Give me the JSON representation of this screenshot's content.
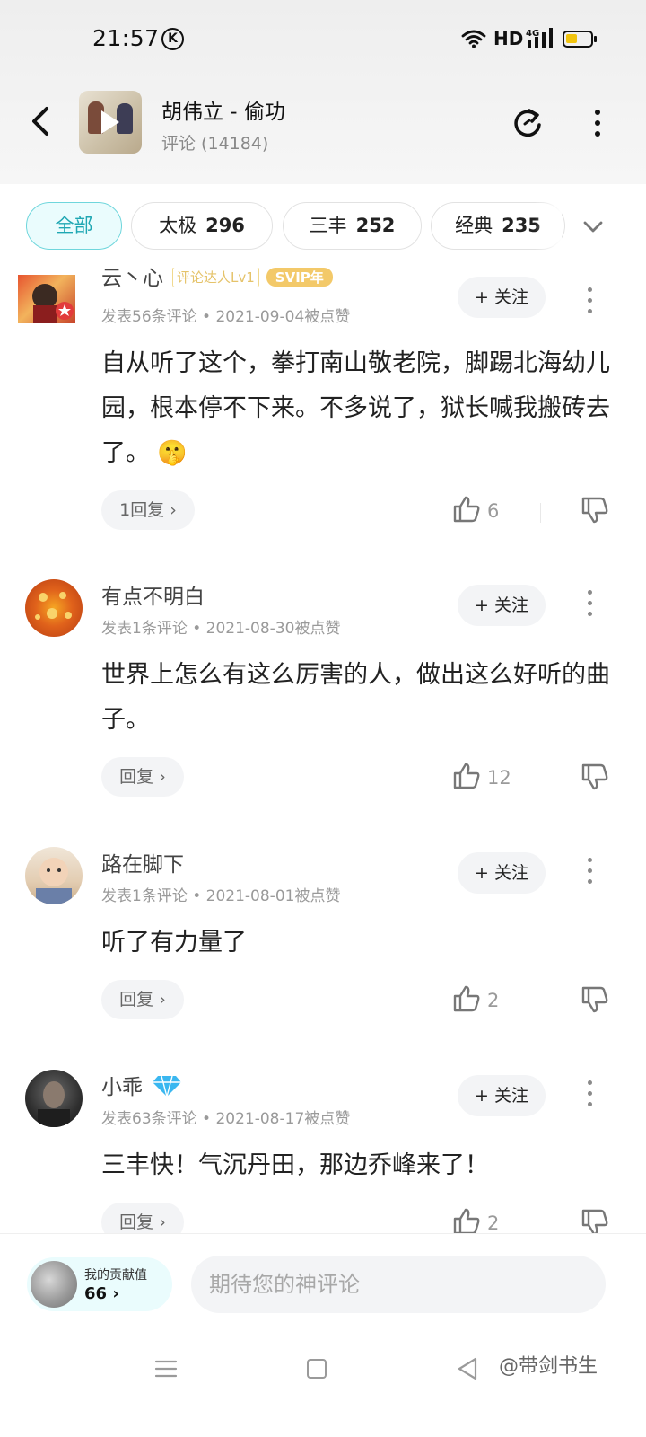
{
  "status_bar": {
    "time": "21:57",
    "k_glyph": "K",
    "network_label": "HD",
    "network_type": "4G",
    "battery_color": "#f1c40f"
  },
  "header": {
    "song_title": "胡伟立 - 偷功",
    "comment_count": "评论 (14184)",
    "album_icon": "album-art",
    "refresh_icon": "refresh-icon"
  },
  "filters": [
    {
      "label": "全部",
      "count": "",
      "active": true
    },
    {
      "label": "太极",
      "count": "296"
    },
    {
      "label": "三丰",
      "count": "252"
    },
    {
      "label": "经典",
      "count": "235"
    }
  ],
  "comments": [
    {
      "username": "云丶心",
      "badge": "评论达人Lv1",
      "vip": "SVIP年",
      "meta": "发表56条评论 • 2021-09-04被点赞",
      "follow": "+ 关注",
      "text": "自从听了这个，拳打南山敬老院，脚踢北海幼儿园，根本停不下来。不多说了，狱长喊我搬砖去了。",
      "emoji": "🤫",
      "reply": "1回复",
      "likes": "6"
    },
    {
      "username": "有点不明白",
      "meta": "发表1条评论 • 2021-08-30被点赞",
      "follow": "+ 关注",
      "text": "世界上怎么有这么厉害的人，做出这么好听的曲子。",
      "reply": "回复",
      "likes": "12"
    },
    {
      "username": "路在脚下",
      "meta": "发表1条评论 • 2021-08-01被点赞",
      "follow": "+ 关注",
      "text": "听了有力量了",
      "reply": "回复",
      "likes": "2"
    },
    {
      "username": "小乖",
      "meta": "发表63条评论 • 2021-08-17被点赞",
      "follow": "+ 关注",
      "text": "三丰快！气沉丹田，那边乔峰来了！",
      "reply": "回复",
      "likes": "2"
    }
  ],
  "bottom_bar": {
    "contrib_label": "我的贡献值",
    "contrib_value": "66",
    "input_placeholder": "期待您的神评论"
  },
  "watermark": "@带剑书生"
}
